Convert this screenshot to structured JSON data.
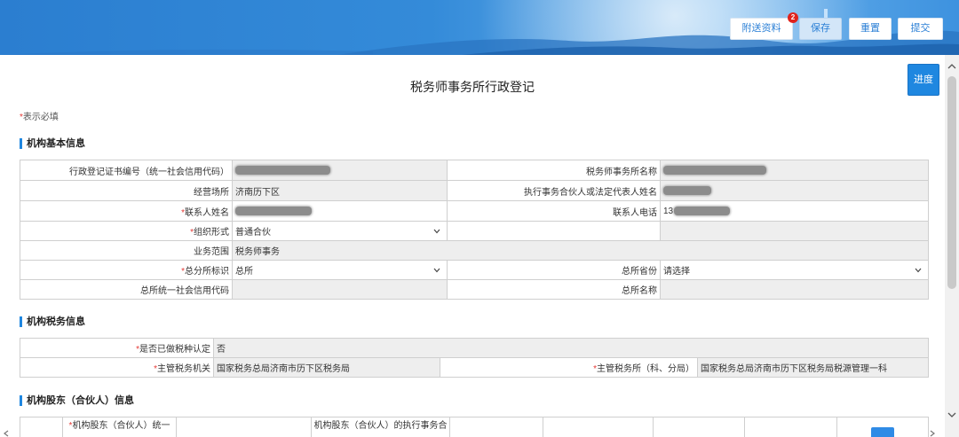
{
  "header": {
    "buttons": {
      "attachments": {
        "label": "附送资料",
        "badge": "2"
      },
      "save": {
        "label": "保存"
      },
      "reset": {
        "label": "重置"
      },
      "submit": {
        "label": "提交"
      }
    }
  },
  "progress_button": {
    "label": "进度"
  },
  "title": "税务师事务所行政登记",
  "required_note": {
    "mark": "*",
    "text": "表示必填"
  },
  "basic_info": {
    "heading": "机构基本信息",
    "fields": {
      "cert_no": {
        "label": "行政登记证书编号（统一社会信用代码）"
      },
      "firm_name": {
        "label": "税务师事务所名称"
      },
      "business_place": {
        "label": "经营场所",
        "value": "济南历下区"
      },
      "legal_rep": {
        "label": "执行事务合伙人或法定代表人姓名"
      },
      "contact_name": {
        "label": "联系人姓名",
        "required": true
      },
      "contact_phone": {
        "label": "联系人电话",
        "value": "13"
      },
      "org_form": {
        "label": "组织形式",
        "required": true,
        "value": "普通合伙"
      },
      "business_scope": {
        "label": "业务范围",
        "value": "税务师事务"
      },
      "hq_flag": {
        "label": "总分所标识",
        "required": true,
        "value": "总所"
      },
      "hq_province": {
        "label": "总所省份",
        "value": "请选择"
      },
      "hq_credit_code": {
        "label": "总所统一社会信用代码",
        "value": ""
      },
      "hq_name": {
        "label": "总所名称",
        "value": ""
      }
    }
  },
  "tax_info": {
    "heading": "机构税务信息",
    "fields": {
      "tax_type_confirmed": {
        "label": "是否已做税种认定",
        "required": true,
        "value": "否"
      },
      "tax_authority": {
        "label": "主管税务机关",
        "required": true,
        "value": "国家税务总局济南市历下区税务局"
      },
      "tax_office": {
        "label": "主管税务所（科、分局）",
        "required": true,
        "value": "国家税务总局济南市历下区税务局税源管理一科"
      }
    }
  },
  "shareholders": {
    "heading": "机构股东（合伙人）信息",
    "columns": [
      {
        "label": ""
      },
      {
        "label": "机构股东（合伙人）统一",
        "required": true
      },
      {
        "label": ""
      },
      {
        "label": "机构股东（合伙人）的执行事务合"
      },
      {
        "label": ""
      },
      {
        "label": ""
      },
      {
        "label": ""
      },
      {
        "label": ""
      },
      {
        "label": ""
      }
    ]
  },
  "icons": {
    "select_arrow": "chevron-down-icon",
    "scroll_up": "chevron-up-icon",
    "scroll_down": "chevron-down-icon",
    "scroll_left": "chevron-left-icon",
    "scroll_right": "chevron-right-icon"
  },
  "colors": {
    "accent": "#1f87e0",
    "required": "#e53935",
    "badge": "#e0231d",
    "readonly_bg": "#eeeeee"
  }
}
